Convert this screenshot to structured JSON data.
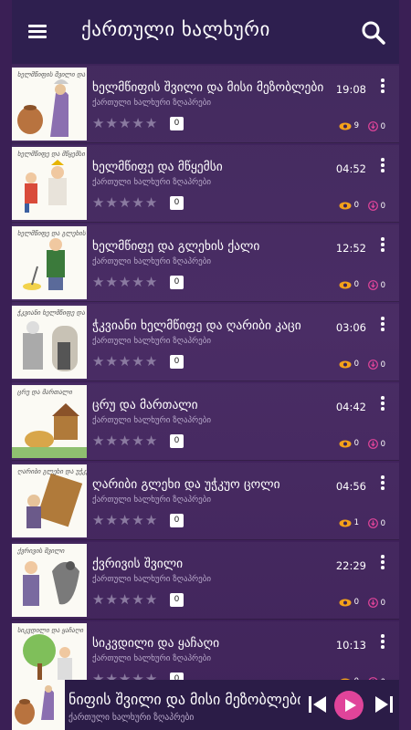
{
  "header": {
    "title": "ქართული ხალხური"
  },
  "colors": {
    "accent": "#e0449a",
    "appbar": "#2e1f4f",
    "background": "#3c2358"
  },
  "items": [
    {
      "title": "ხელმწიფის შვილი და მისი მეზობლები",
      "subtitle": "ქართული ხალხური ზღაპრები",
      "duration": "19:08",
      "rating": "0",
      "views": "9",
      "downloads": "0",
      "caption": "ხელმწიფის შვილი და მისი მეზობლები"
    },
    {
      "title": "ხელმწიფე და მწყემსი",
      "subtitle": "ქართული ხალხური ზღაპრები",
      "duration": "04:52",
      "rating": "0",
      "views": "0",
      "downloads": "0",
      "caption": "ხელმწიფე და მწყემსი"
    },
    {
      "title": "ხელმწიფე და გლეხის ქალი",
      "subtitle": "ქართული ხალხური ზღაპრები",
      "duration": "12:52",
      "rating": "0",
      "views": "0",
      "downloads": "0",
      "caption": "ხელმწიფე და გლეხის ქალი"
    },
    {
      "title": "ჭკვიანი ხელმწიფე და ღარიბი კაცი",
      "subtitle": "ქართული ხალხური ზღაპრები",
      "duration": "03:06",
      "rating": "0",
      "views": "0",
      "downloads": "0",
      "caption": "ჭკვიანი ხელმწიფე და ღარიბი კაცი"
    },
    {
      "title": "ცრუ და მართალი",
      "subtitle": "ქართული ხალხური ზღაპრები",
      "duration": "04:42",
      "rating": "0",
      "views": "0",
      "downloads": "0",
      "caption": "ცრუ და მართალი"
    },
    {
      "title": "ღარიბი გლეხი და უჭკუო ცოლი",
      "subtitle": "ქართული ხალხური ზღაპრები",
      "duration": "04:56",
      "rating": "0",
      "views": "1",
      "downloads": "0",
      "caption": "ღარიბი გლეხი და უჭკუო ცოლი"
    },
    {
      "title": "ქვრივის შვილი",
      "subtitle": "ქართული ხალხური ზღაპრები",
      "duration": "22:29",
      "rating": "0",
      "views": "0",
      "downloads": "0",
      "caption": "ქვრივის შვილი"
    },
    {
      "title": "სიკვდილი და ყაჩაღი",
      "subtitle": "ქართული ხალხური ზღაპრები",
      "duration": "10:13",
      "rating": "0",
      "views": "0",
      "downloads": "0",
      "caption": "სიკვდილი და ყაჩაღი"
    }
  ],
  "player": {
    "title": "ნიფის შვილი და მისი მეზობლები",
    "subtitle": "ქართული ხალხური ზღაპრები",
    "icons": {
      "prev": "skip-previous-icon",
      "play": "play-icon",
      "next": "skip-next-icon"
    }
  },
  "icons": {
    "menu": "menu-icon",
    "search": "search-icon",
    "more": "more-vertical-icon",
    "views": "eye-icon",
    "downloads": "download-icon",
    "star": "star-icon"
  }
}
